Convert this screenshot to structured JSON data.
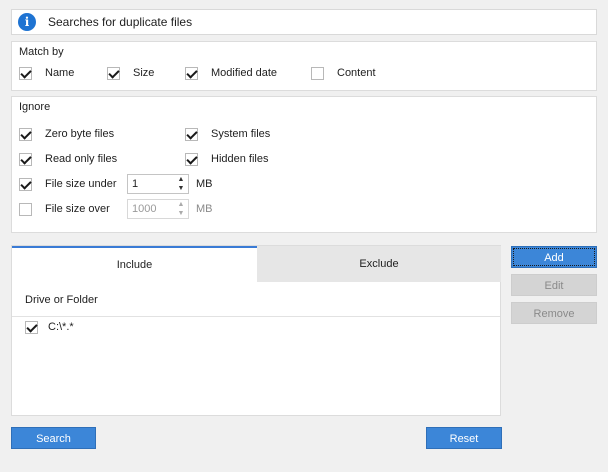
{
  "banner": {
    "text": "Searches for duplicate files",
    "icon": "info-icon"
  },
  "match_by": {
    "title": "Match by",
    "options": [
      {
        "label": "Name",
        "checked": true
      },
      {
        "label": "Size",
        "checked": true
      },
      {
        "label": "Modified date",
        "checked": true
      },
      {
        "label": "Content",
        "checked": false
      }
    ]
  },
  "ignore": {
    "title": "Ignore",
    "zero_byte": {
      "label": "Zero byte files",
      "checked": true
    },
    "system": {
      "label": "System files",
      "checked": true
    },
    "read_only": {
      "label": "Read only files",
      "checked": true
    },
    "hidden": {
      "label": "Hidden files",
      "checked": true
    },
    "size_under": {
      "label": "File size under",
      "checked": true,
      "value": "1",
      "unit": "MB"
    },
    "size_over": {
      "label": "File size over",
      "checked": false,
      "value": "1000",
      "unit": "MB"
    }
  },
  "tabs": {
    "include": "Include",
    "exclude": "Exclude",
    "active": "include"
  },
  "table": {
    "header": "Drive or Folder",
    "rows": [
      {
        "path": "C:\\*.*",
        "checked": true
      }
    ]
  },
  "side_buttons": {
    "add": "Add",
    "edit": "Edit",
    "remove": "Remove"
  },
  "footer": {
    "search": "Search",
    "reset": "Reset"
  },
  "colors": {
    "accent": "#3c86d8",
    "info": "#1e73d2"
  }
}
